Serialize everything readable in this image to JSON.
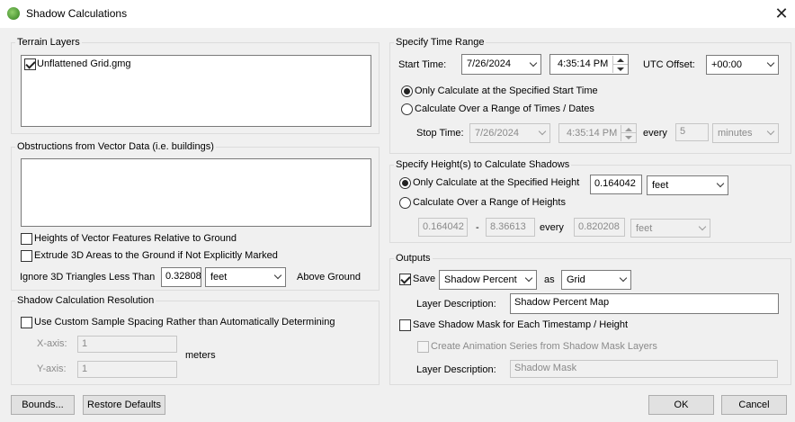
{
  "window": {
    "title": "Shadow Calculations",
    "icon": "globe-app-icon",
    "close_glyph": "✕"
  },
  "terrain": {
    "legend": "Terrain Layers",
    "items": [
      {
        "label": "Unflattened Grid.gmg",
        "checked": true
      }
    ]
  },
  "obstructions": {
    "legend": "Obstructions from Vector Data (i.e. buildings)",
    "heights_relative_label": "Heights of Vector Features Relative to Ground",
    "extrude_label": "Extrude 3D Areas to the Ground if Not Explicitly Marked",
    "ignore_label": "Ignore 3D Triangles Less Than",
    "ignore_value": "0.32808",
    "ignore_unit": "feet",
    "above_ground_label": "Above Ground"
  },
  "resolution": {
    "legend": "Shadow Calculation Resolution",
    "custom_label": "Use Custom Sample Spacing Rather than Automatically Determining",
    "x_label": "X-axis:",
    "x_value": "1",
    "y_label": "Y-axis:",
    "y_value": "1",
    "unit_label": "meters"
  },
  "time_range": {
    "legend": "Specify Time Range",
    "start_label": "Start Time:",
    "start_date": "7/26/2024",
    "start_time": "4:35:14 PM",
    "utc_label": "UTC Offset:",
    "utc_value": "+00:00",
    "only_start_label": "Only Calculate at the Specified Start Time",
    "range_label": "Calculate Over a Range of Times / Dates",
    "stop_label": "Stop Time:",
    "stop_date": "7/26/2024",
    "stop_time": "4:35:14 PM",
    "every_label": "every",
    "every_value": "5",
    "every_unit": "minutes"
  },
  "heights": {
    "legend": "Specify Height(s) to Calculate Shadows",
    "only_label": "Only Calculate at the Specified Height",
    "height_value": "0.164042",
    "height_unit": "feet",
    "range_label": "Calculate Over a Range of Heights",
    "range_from": "0.164042",
    "range_dash": "-",
    "range_to": "8.36613",
    "every_label": "every",
    "every_value": "0.820208",
    "every_unit": "feet"
  },
  "outputs": {
    "legend": "Outputs",
    "save_label": "Save",
    "save_type": "Shadow Percent",
    "as_label": "as",
    "as_type": "Grid",
    "layer_desc_label": "Layer Description:",
    "layer_desc_value": "Shadow Percent Map",
    "mask_label": "Save Shadow Mask for Each Timestamp / Height",
    "animation_label": "Create Animation Series from Shadow Mask Layers",
    "mask_desc_label": "Layer Description:",
    "mask_desc_value": "Shadow Mask"
  },
  "buttons": {
    "bounds": "Bounds...",
    "restore": "Restore Defaults",
    "ok": "OK",
    "cancel": "Cancel"
  }
}
